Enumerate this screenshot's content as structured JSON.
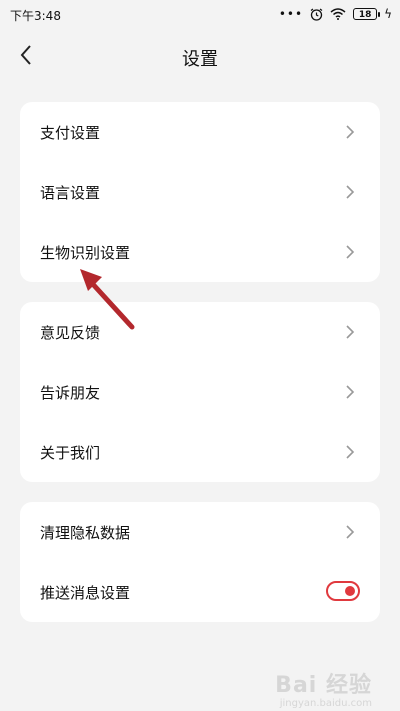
{
  "status_bar": {
    "time": "下午3:48",
    "dots": "•••",
    "battery": "18"
  },
  "header": {
    "title": "设置"
  },
  "groups": [
    {
      "items": [
        {
          "label": "支付设置"
        },
        {
          "label": "语言设置"
        },
        {
          "label": "生物识别设置"
        }
      ]
    },
    {
      "items": [
        {
          "label": "意见反馈"
        },
        {
          "label": "告诉朋友"
        },
        {
          "label": "关于我们"
        }
      ]
    },
    {
      "items": [
        {
          "label": "清理隐私数据"
        },
        {
          "label": "推送消息设置"
        }
      ]
    }
  ],
  "push_toggle": {
    "on": true
  },
  "colors": {
    "accent": "#e0393e",
    "arrow": "#b3282d",
    "background": "#f3f3f3"
  },
  "watermark": {
    "text": "Bai 经验",
    "sub": "jingyan.baidu.com"
  }
}
